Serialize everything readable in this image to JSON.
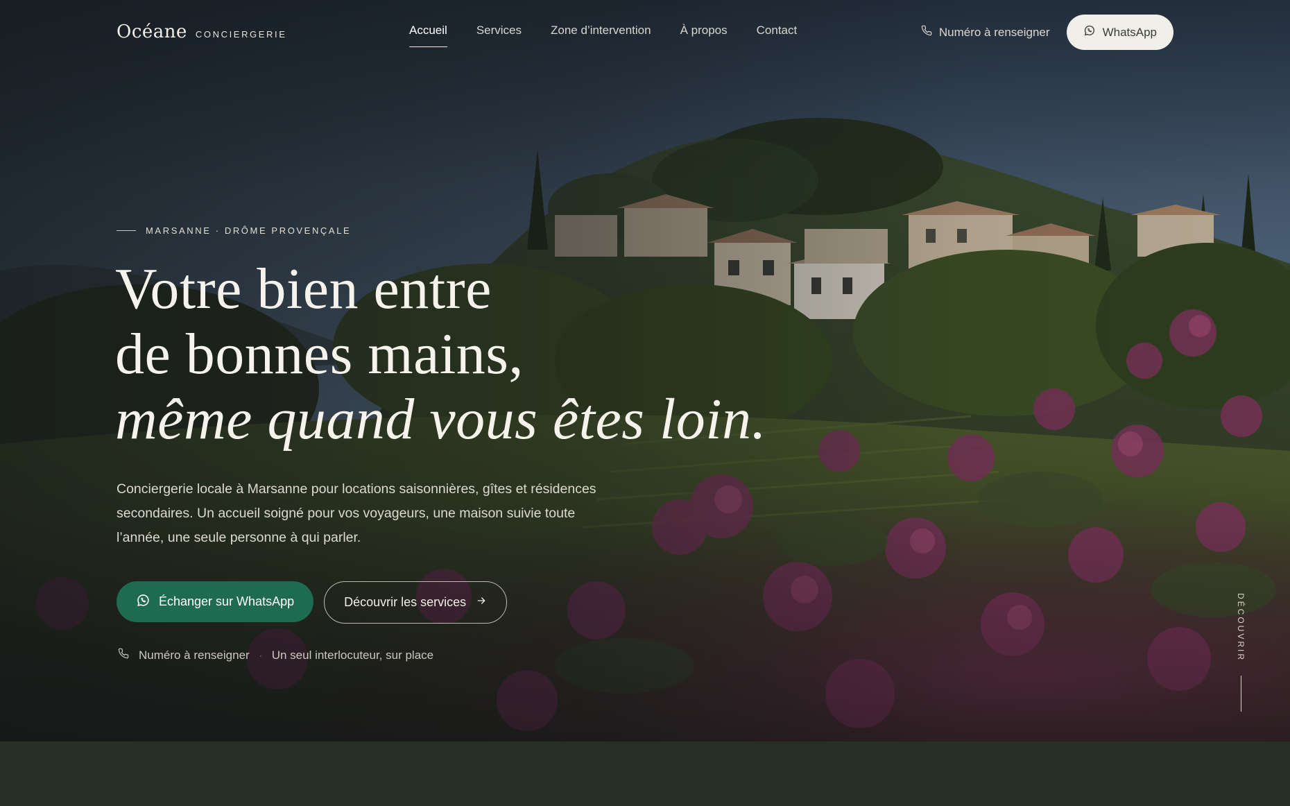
{
  "header": {
    "logo_name": "Océane",
    "logo_sub": "CONCIERGERIE",
    "nav": [
      {
        "label": "Accueil",
        "active": true
      },
      {
        "label": "Services"
      },
      {
        "label": "Zone d’intervention"
      },
      {
        "label": "À propos"
      },
      {
        "label": "Contact"
      }
    ],
    "phone_label": "Numéro à renseigner",
    "whatsapp_label": "WhatsApp"
  },
  "hero": {
    "eyebrow": "MARSANNE · DRÔME PROVENÇALE",
    "headline_line1": "Votre bien entre",
    "headline_line2": "de bonnes mains,",
    "headline_line3": "même quand vous êtes loin.",
    "lead": "Conciergerie locale à Marsanne pour locations saisonnières, gîtes et résidences secondaires. Un accueil soigné pour vos voyageurs, une maison suivie toute l’année, une seule personne à qui parler.",
    "cta_whatsapp": "Échanger sur WhatsApp",
    "cta_services": "Découvrir les services",
    "meta_phone": "Numéro à renseigner",
    "meta_separator": "·",
    "meta_tagline": "Un seul interlocuteur, sur place",
    "scroll_label": "DÉCOUVRIR"
  },
  "colors": {
    "accent_green": "#1f6b52",
    "bottom_band": "#283026",
    "pill_bg": "#f1efea"
  },
  "icons": {
    "phone": "phone-icon",
    "whatsapp": "whatsapp-icon",
    "arrow": "arrow-right-icon"
  }
}
